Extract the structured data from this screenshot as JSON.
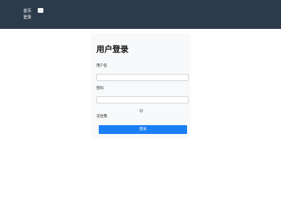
{
  "nav": {
    "home_label": "首页",
    "login_label": "登录"
  },
  "login_card": {
    "title": "用户登录",
    "username_label": "用户名",
    "username_value": "",
    "password_label": "密码",
    "password_value": "",
    "remember_label": "记住我",
    "remember_checked": false,
    "submit_label": "登录"
  },
  "colors": {
    "topbar_bg": "#2d3a4b",
    "button_bg": "#1a7ef5",
    "card_bg": "#f8f9fa"
  }
}
